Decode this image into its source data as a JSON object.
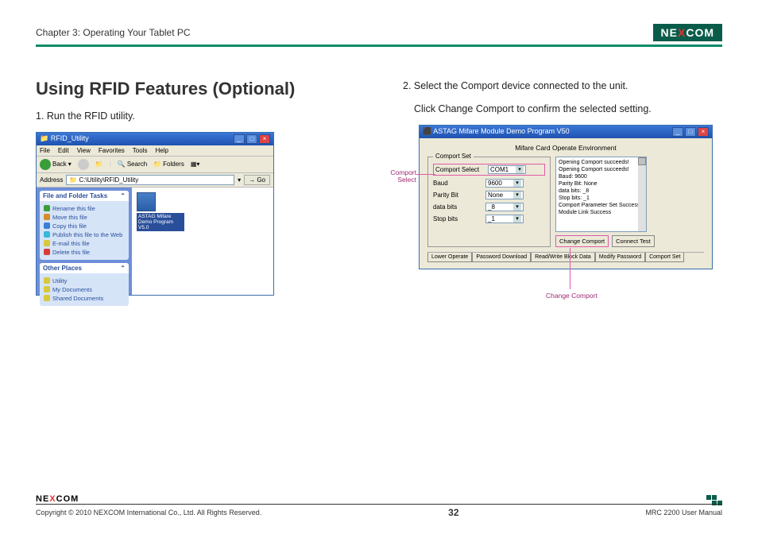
{
  "header": {
    "chapter": "Chapter 3: Operating Your Tablet PC",
    "logo_text_pre": "NE",
    "logo_text_x": "X",
    "logo_text_post": "COM"
  },
  "content": {
    "heading": "Using RFID Features (Optional)",
    "step1": "1. Run the RFID utility.",
    "step2_line1": "2. Select the Comport device connected to the unit.",
    "step2_line2": "Click Change Comport to confirm the selected setting."
  },
  "explorer": {
    "title": "RFID_Utility",
    "menu": [
      "File",
      "Edit",
      "View",
      "Favorites",
      "Tools",
      "Help"
    ],
    "toolbar": {
      "back": "Back",
      "search": "Search",
      "folders": "Folders"
    },
    "address_label": "Address",
    "address_value": "C:\\Utility\\RFID_Utility",
    "go": "Go",
    "panel1_title": "File and Folder Tasks",
    "panel1_items": [
      "Rename this file",
      "Move this file",
      "Copy this file",
      "Publish this file to the Web",
      "E-mail this file",
      "Delete this file"
    ],
    "panel2_title": "Other Places",
    "panel2_items": [
      "Utility",
      "My Documents",
      "Shared Documents"
    ],
    "file_name": "ASTAG Mifare Demo Program V5.0"
  },
  "mifare": {
    "title": "ASTAG Mifare Module Demo Program V50",
    "env_title": "Mifare Card Operate Environment",
    "comport_set_legend": "Comport Set",
    "rows": {
      "comport_label": "Comport Select",
      "comport_value": "COM1",
      "baud_label": "Baud",
      "baud_value": "9600",
      "parity_label": "Parity Bit",
      "parity_value": "None",
      "data_label": "data bits",
      "data_value": "_8",
      "stop_label": "Stop bits",
      "stop_value": "_1"
    },
    "log_lines": [
      "Opening Comport succeeds!",
      "Opening Comport succeeds!",
      "Baud: 9600",
      "Parity Bit: None",
      "data bits: _8",
      "Stop bits: _1",
      "Comport Parameter Set Success",
      "",
      "Module Link Success"
    ],
    "btn_change": "Change Comport",
    "btn_connect": "Connect Test",
    "tabs": [
      "Lower Operate",
      "Password Download",
      "Read/Write Block Data",
      "Modify Password",
      "Comport Set"
    ],
    "annot_comport": "Comport Select",
    "annot_change": "Change Comport"
  },
  "footer": {
    "copyright": "Copyright © 2010 NEXCOM International Co., Ltd. All Rights Reserved.",
    "page_num": "32",
    "manual": "MRC 2200 User Manual"
  }
}
